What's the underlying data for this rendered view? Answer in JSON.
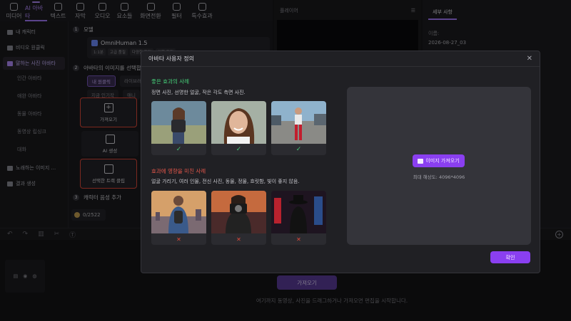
{
  "toolbar": {
    "items": [
      {
        "label": "미디어",
        "icon": "media-icon"
      },
      {
        "label": "AI 아바타",
        "icon": "ai-avatar-icon",
        "active": true
      },
      {
        "label": "텍스트",
        "icon": "text-icon"
      },
      {
        "label": "자막",
        "icon": "subtitle-icon"
      },
      {
        "label": "오디오",
        "icon": "audio-icon"
      },
      {
        "label": "요소들",
        "icon": "elements-icon"
      },
      {
        "label": "화면전환",
        "icon": "transition-icon"
      },
      {
        "label": "필터",
        "icon": "filter-icon"
      },
      {
        "label": "특수효과",
        "icon": "effects-icon"
      }
    ]
  },
  "sidebar": {
    "items": [
      {
        "label": "내 캐릭터"
      },
      {
        "label": "비디오 원클릭"
      },
      {
        "label": "말하는 사진 아바타",
        "active": true
      }
    ],
    "subitems": [
      "인간 아바타",
      "애완 아바타",
      "동물 아바타",
      "동영상 립싱크",
      "대화"
    ],
    "bottom": [
      {
        "label": "노래하는 이미지 ..."
      },
      {
        "label": "결과 생성"
      }
    ]
  },
  "panel": {
    "step1": {
      "num": "1",
      "label": "모델"
    },
    "model": {
      "name": "OmniHuman 1.5",
      "chips": [
        "1:1분",
        "고급 품질",
        "다양한 장면",
        "인물 특징"
      ]
    },
    "step2": {
      "num": "2",
      "label": "아바타의 이미지를 선택합니다"
    },
    "tabs": [
      "내 원클릭",
      "라이브러리"
    ],
    "subtabs": [
      "지금 인기작",
      "애니"
    ],
    "cards": {
      "import": "가져오기",
      "ai": "AI 생성",
      "select": "선택한 트랙 클립"
    },
    "step3": {
      "num": "3",
      "label": "캐릭터 음성 추가"
    },
    "credits": "0/2522"
  },
  "player": {
    "title": "플레이어"
  },
  "details": {
    "tab": "세부 사항",
    "label": "이름:",
    "value": "2026-08-27_03"
  },
  "timeline": {
    "import_label": "가져오기",
    "hint": "여기까지 동영상, 사진을 드래그하거나 가져오면 편집을 시작합니다.",
    "track_icons": [
      "▤",
      "◉",
      "◍"
    ]
  },
  "modal": {
    "title": "아바타 사용자 정의",
    "good_title": "좋은 효과의 사례",
    "good_desc": "정면 사진, 선명한 얼굴, 작은 각도 측면 사진.",
    "bad_title": "효과에 영향을 미친 사례",
    "bad_desc": "얼굴 가리기, 여러 인물, 전신 사진, 동물, 정물, 흐릿함, 빛이 좋지 않음.",
    "good_mark": "✓",
    "bad_mark": "✕",
    "upload_label": "이미지 가져오기",
    "max_res": "최대 해상도: 4096*4096",
    "confirm": "확인"
  }
}
